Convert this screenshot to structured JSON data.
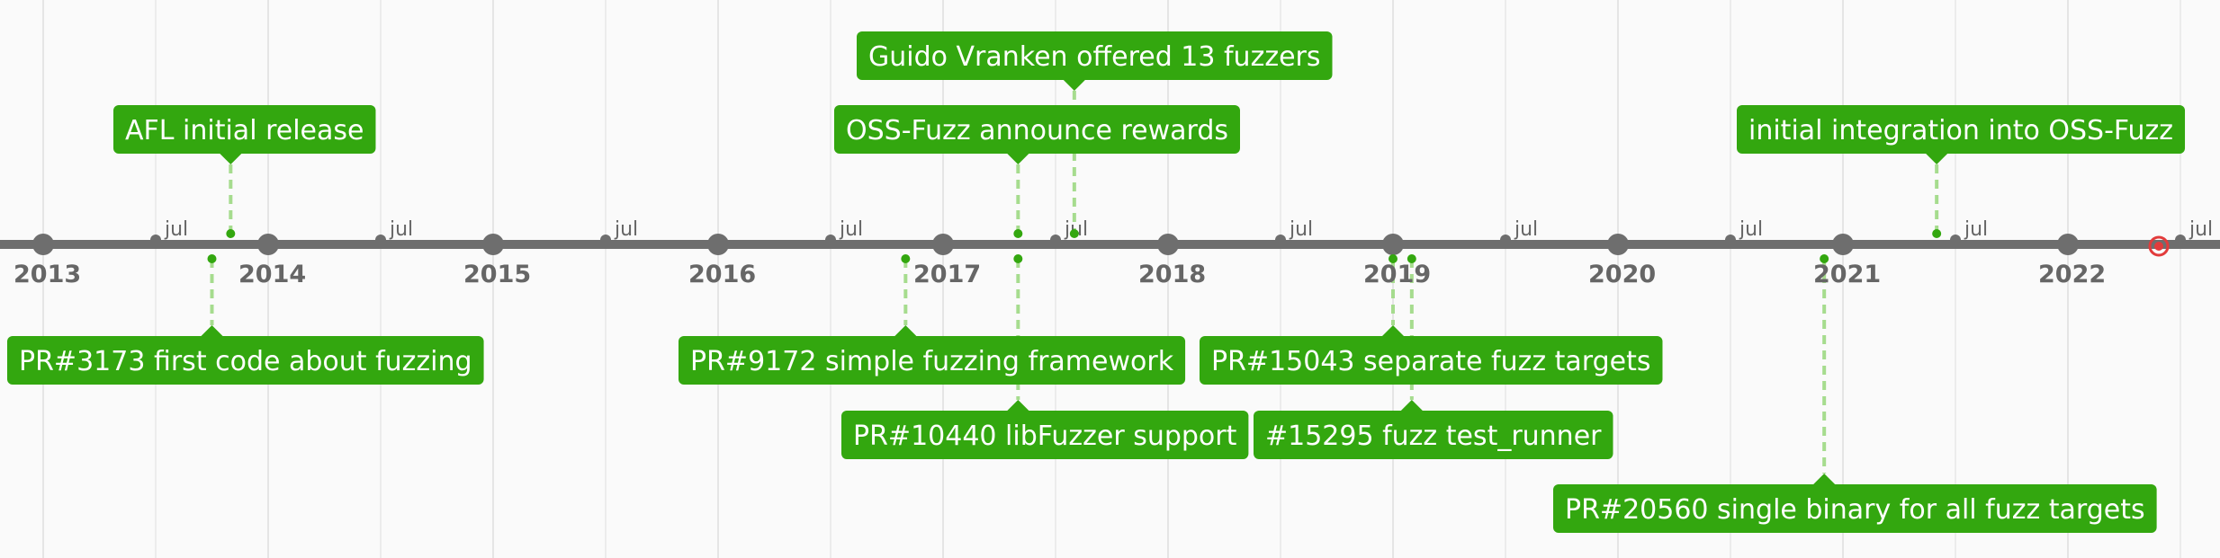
{
  "axis": {
    "years": [
      "2013",
      "2014",
      "2015",
      "2016",
      "2017",
      "2018",
      "2019",
      "2020",
      "2021",
      "2022"
    ],
    "half_year_label": "jul",
    "marker_color": "#e23b3b"
  },
  "colors": {
    "accent": "#33a70f",
    "connector": "#a6dc8e",
    "axis": "#6e6e6e",
    "background": "#fafafa"
  },
  "events": [
    {
      "text": "Guido Vranken offered 13 fuzzers",
      "position": "above",
      "date": "2017-08"
    },
    {
      "text": "AFL initial release",
      "position": "above",
      "date": "2013-11"
    },
    {
      "text": "OSS-Fuzz announce rewards",
      "position": "above",
      "date": "2017-05"
    },
    {
      "text": "initial integration into OSS-Fuzz",
      "position": "above",
      "date": "2021-06"
    },
    {
      "text": "PR#3173 first code about fuzzing",
      "position": "below",
      "date": "2013-10"
    },
    {
      "text": "PR#9172 simple fuzzing framework",
      "position": "below",
      "date": "2016-11"
    },
    {
      "text": "PR#10440 libFuzzer support",
      "position": "below",
      "date": "2017-05"
    },
    {
      "text": "PR#15043 separate fuzz targets",
      "position": "below",
      "date": "2019-01"
    },
    {
      "text": "#15295 fuzz test_runner",
      "position": "below",
      "date": "2019-02"
    },
    {
      "text": "PR#20560 single binary for all fuzz targets",
      "position": "below",
      "date": "2020-12"
    }
  ]
}
